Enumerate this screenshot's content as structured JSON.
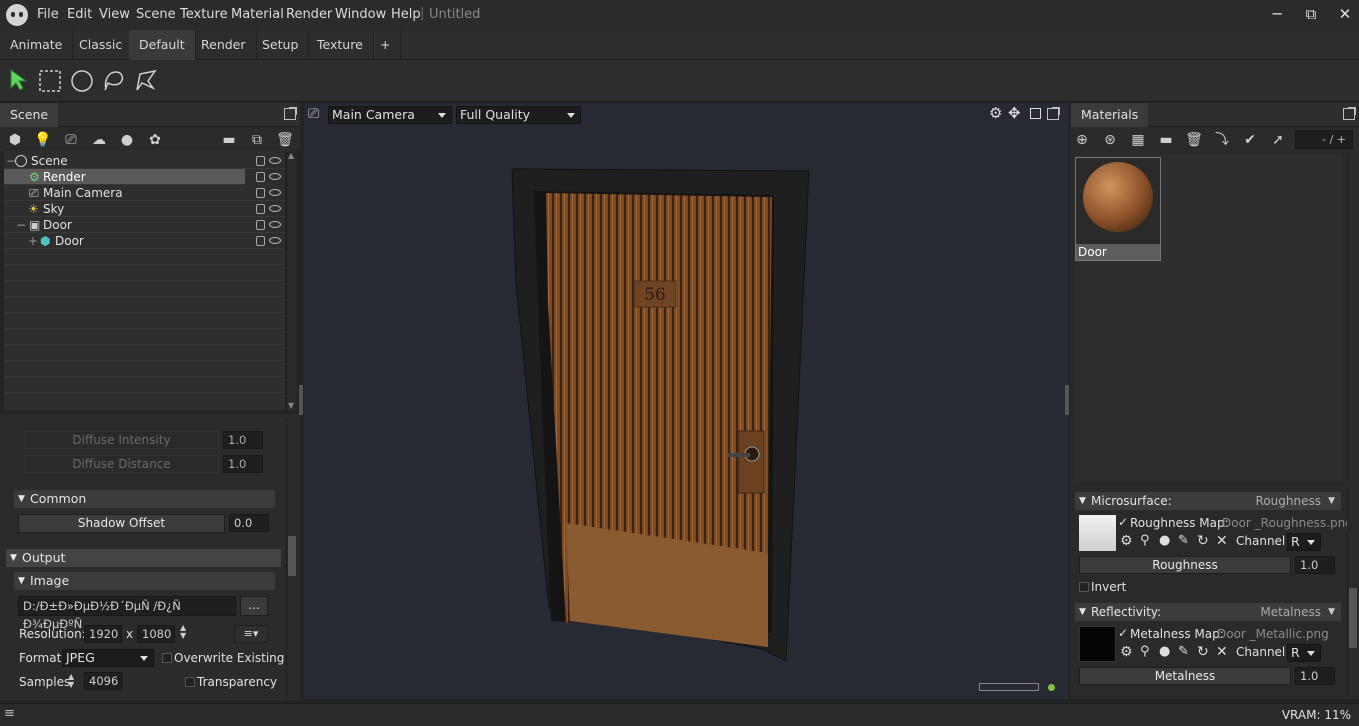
{
  "app": {
    "title": "Untitled"
  },
  "menu": [
    "File",
    "Edit",
    "View",
    "Scene",
    "Texture",
    "Material",
    "Render",
    "Window",
    "Help"
  ],
  "window_controls": {
    "minimize": "─",
    "maximize": "⧉",
    "close": "✕"
  },
  "workspace_tabs": [
    "Animate",
    "Classic",
    "Default",
    "Render",
    "Setup",
    "Texture",
    "+"
  ],
  "active_tab": "Default",
  "tools": [
    "select-arrow-icon",
    "rect-select-icon",
    "ellipse-select-icon",
    "lasso-icon",
    "polygon-lasso-icon"
  ],
  "scene_panel": {
    "tab": "Scene",
    "tree": [
      {
        "label": "Scene",
        "depth": 0,
        "icon": "scene-icon"
      },
      {
        "label": "Render",
        "depth": 1,
        "icon": "render-icon",
        "selected": true
      },
      {
        "label": "Main Camera",
        "depth": 1,
        "icon": "camera-icon"
      },
      {
        "label": "Sky",
        "depth": 1,
        "icon": "sky-icon"
      },
      {
        "label": "Door",
        "depth": 1,
        "icon": "group-icon"
      },
      {
        "label": "Door",
        "depth": 2,
        "icon": "mesh-icon"
      }
    ]
  },
  "properties": {
    "diffuse_intensity": {
      "label": "Diffuse Intensity",
      "value": "1.0"
    },
    "diffuse_distance": {
      "label": "Diffuse Distance",
      "value": "1.0"
    },
    "common_header": "Common",
    "shadow_offset": {
      "label": "Shadow Offset",
      "value": "0.0"
    },
    "output_header": "Output",
    "image_header": "Image",
    "path": "D:/Đ±Đ»ĐµĐ½Đ´ĐµÑ /Đ¿Ñ  Đ¾ĐµĐºÑ",
    "browse_label": "...",
    "resolution_label": "Resolution:",
    "res_w": "1920",
    "res_x": "x",
    "res_h": "1080",
    "format_label": "Format",
    "format_value": "JPEG",
    "overwrite_label": "Overwrite Existing",
    "samples_label": "Samples",
    "samples_value": "4096",
    "transparency_label": "Transparency"
  },
  "viewport": {
    "camera": "Main Camera",
    "quality": "Full Quality",
    "door_number": "56"
  },
  "materials_panel": {
    "tab": "Materials",
    "counter": "- / +",
    "material_name": "Door",
    "microsurface": {
      "header": "Microsurface:",
      "mode": "Roughness",
      "map_label": "Roughness Map:",
      "map_file": "Door _Roughness.png",
      "channel_label": "Channel",
      "channel": "R",
      "slider_label": "Roughness",
      "slider_value": "1.0",
      "invert_label": "Invert"
    },
    "reflectivity": {
      "header": "Reflectivity:",
      "mode": "Metalness",
      "map_label": "Metalness Map:",
      "map_file": "Door _Metallic.png",
      "channel_label": "Channel",
      "channel": "R",
      "slider_label": "Metalness",
      "slider_value": "1.0"
    }
  },
  "status": {
    "vram": "VRAM: 11%"
  }
}
